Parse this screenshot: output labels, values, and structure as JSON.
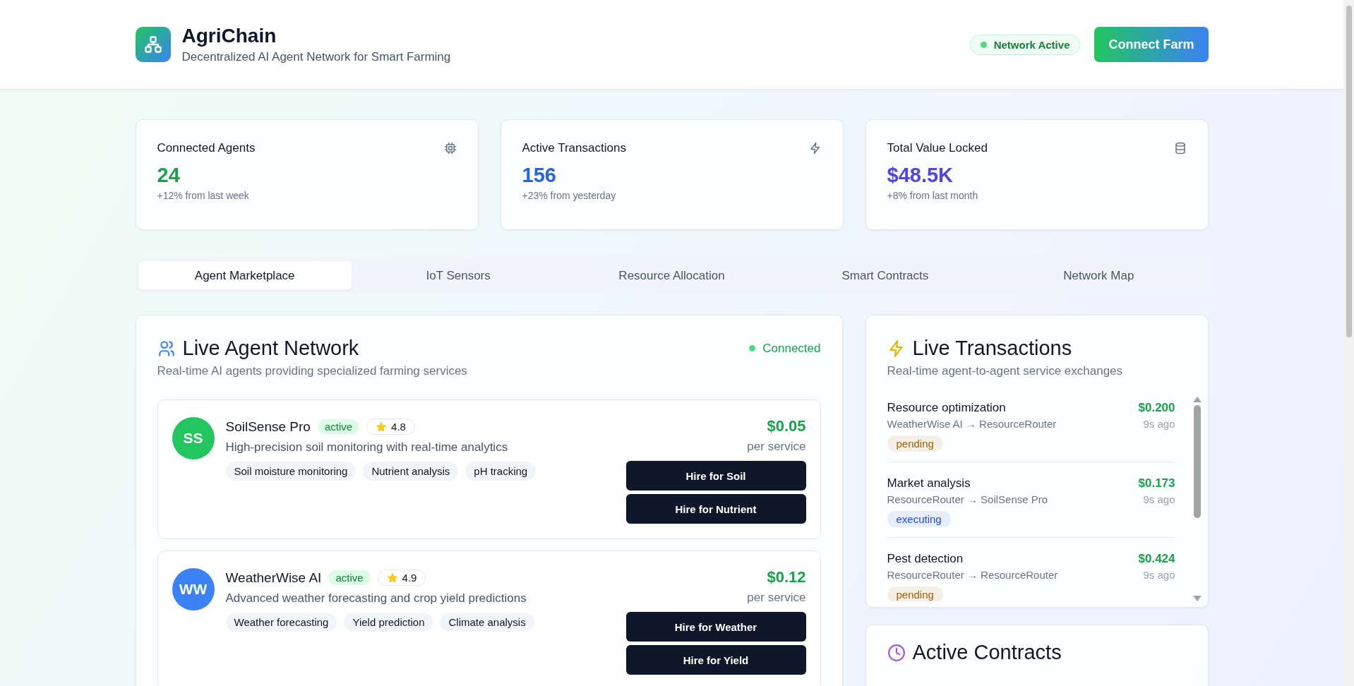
{
  "header": {
    "title": "AgriChain",
    "subtitle": "Decentralized AI Agent Network for Smart Farming",
    "network_status": "Network Active",
    "connect_button": "Connect Farm"
  },
  "stats": [
    {
      "label": "Connected Agents",
      "value": "24",
      "color": "#16a34a",
      "change": "+12% from last week"
    },
    {
      "label": "Active Transactions",
      "value": "156",
      "color": "#2563eb",
      "change": "+23% from yesterday"
    },
    {
      "label": "Total Value Locked",
      "value": "$48.5K",
      "color": "#4f46e5",
      "change": "+8% from last month"
    }
  ],
  "tabs": [
    {
      "label": "Agent Marketplace",
      "selected": true
    },
    {
      "label": "IoT Sensors",
      "selected": false
    },
    {
      "label": "Resource Allocation",
      "selected": false
    },
    {
      "label": "Smart Contracts",
      "selected": false
    },
    {
      "label": "Network Map",
      "selected": false
    }
  ],
  "agent_network": {
    "title": "Live Agent Network",
    "subtitle": "Real-time AI agents providing specialized farming services",
    "connection": "Connected",
    "agents": [
      {
        "initials": "SS",
        "color": "#22c55e",
        "name": "SoilSense Pro",
        "status": "active",
        "rating": "4.8",
        "description": "High-precision soil monitoring with real-time analytics",
        "tags": [
          "Soil moisture monitoring",
          "Nutrient analysis",
          "pH tracking"
        ],
        "price": "$0.05",
        "price_unit": "per service",
        "actions": [
          "Hire for Soil",
          "Hire for Nutrient"
        ]
      },
      {
        "initials": "WW",
        "color": "#3b82f6",
        "name": "WeatherWise AI",
        "status": "active",
        "rating": "4.9",
        "description": "Advanced weather forecasting and crop yield predictions",
        "tags": [
          "Weather forecasting",
          "Yield prediction",
          "Climate analysis"
        ],
        "price": "$0.12",
        "price_unit": "per service",
        "actions": [
          "Hire for Weather",
          "Hire for Yield"
        ]
      }
    ]
  },
  "live_transactions": {
    "title": "Live Transactions",
    "subtitle": "Real-time agent-to-agent service exchanges",
    "items": [
      {
        "service": "Resource optimization",
        "route": "WeatherWise AI → ResourceRouter",
        "amount": "$0.200",
        "time": "9s ago",
        "status": "pending",
        "color": "#a16207"
      },
      {
        "service": "Market analysis",
        "route": "ResourceRouter → SoilSense Pro",
        "amount": "$0.173",
        "time": "9s ago",
        "status": "executing",
        "color": "#1d4ed8"
      },
      {
        "service": "Pest detection",
        "route": "ResourceRouter → ResourceRouter",
        "amount": "$0.424",
        "time": "9s ago",
        "status": "pending",
        "color": "#a16207"
      }
    ]
  },
  "active_contracts": {
    "title": "Active Contracts"
  }
}
